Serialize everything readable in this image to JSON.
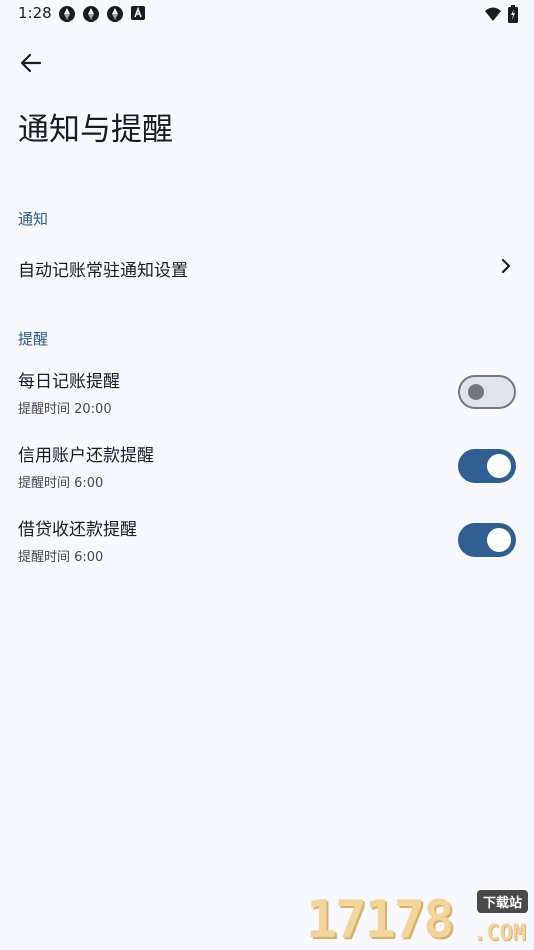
{
  "status_bar": {
    "time": "1:28"
  },
  "header": {
    "title": "通知与提醒"
  },
  "sections": {
    "notification": {
      "header": "通知",
      "items": [
        {
          "label": "自动记账常驻通知设置"
        }
      ]
    },
    "reminder": {
      "header": "提醒",
      "items": [
        {
          "title": "每日记账提醒",
          "subtitle": "提醒时间 20:00",
          "enabled": false
        },
        {
          "title": "信用账户还款提醒",
          "subtitle": "提醒时间 6:00",
          "enabled": true
        },
        {
          "title": "借贷收还款提醒",
          "subtitle": "提醒时间 6:00",
          "enabled": true
        }
      ]
    }
  },
  "watermark": {
    "digits": "17178",
    "badge": "下载站",
    "suffix": ".COM"
  },
  "colors": {
    "background": "#f8f9ff",
    "accent": "#2f5f93",
    "section_header": "#2d5a8e"
  }
}
